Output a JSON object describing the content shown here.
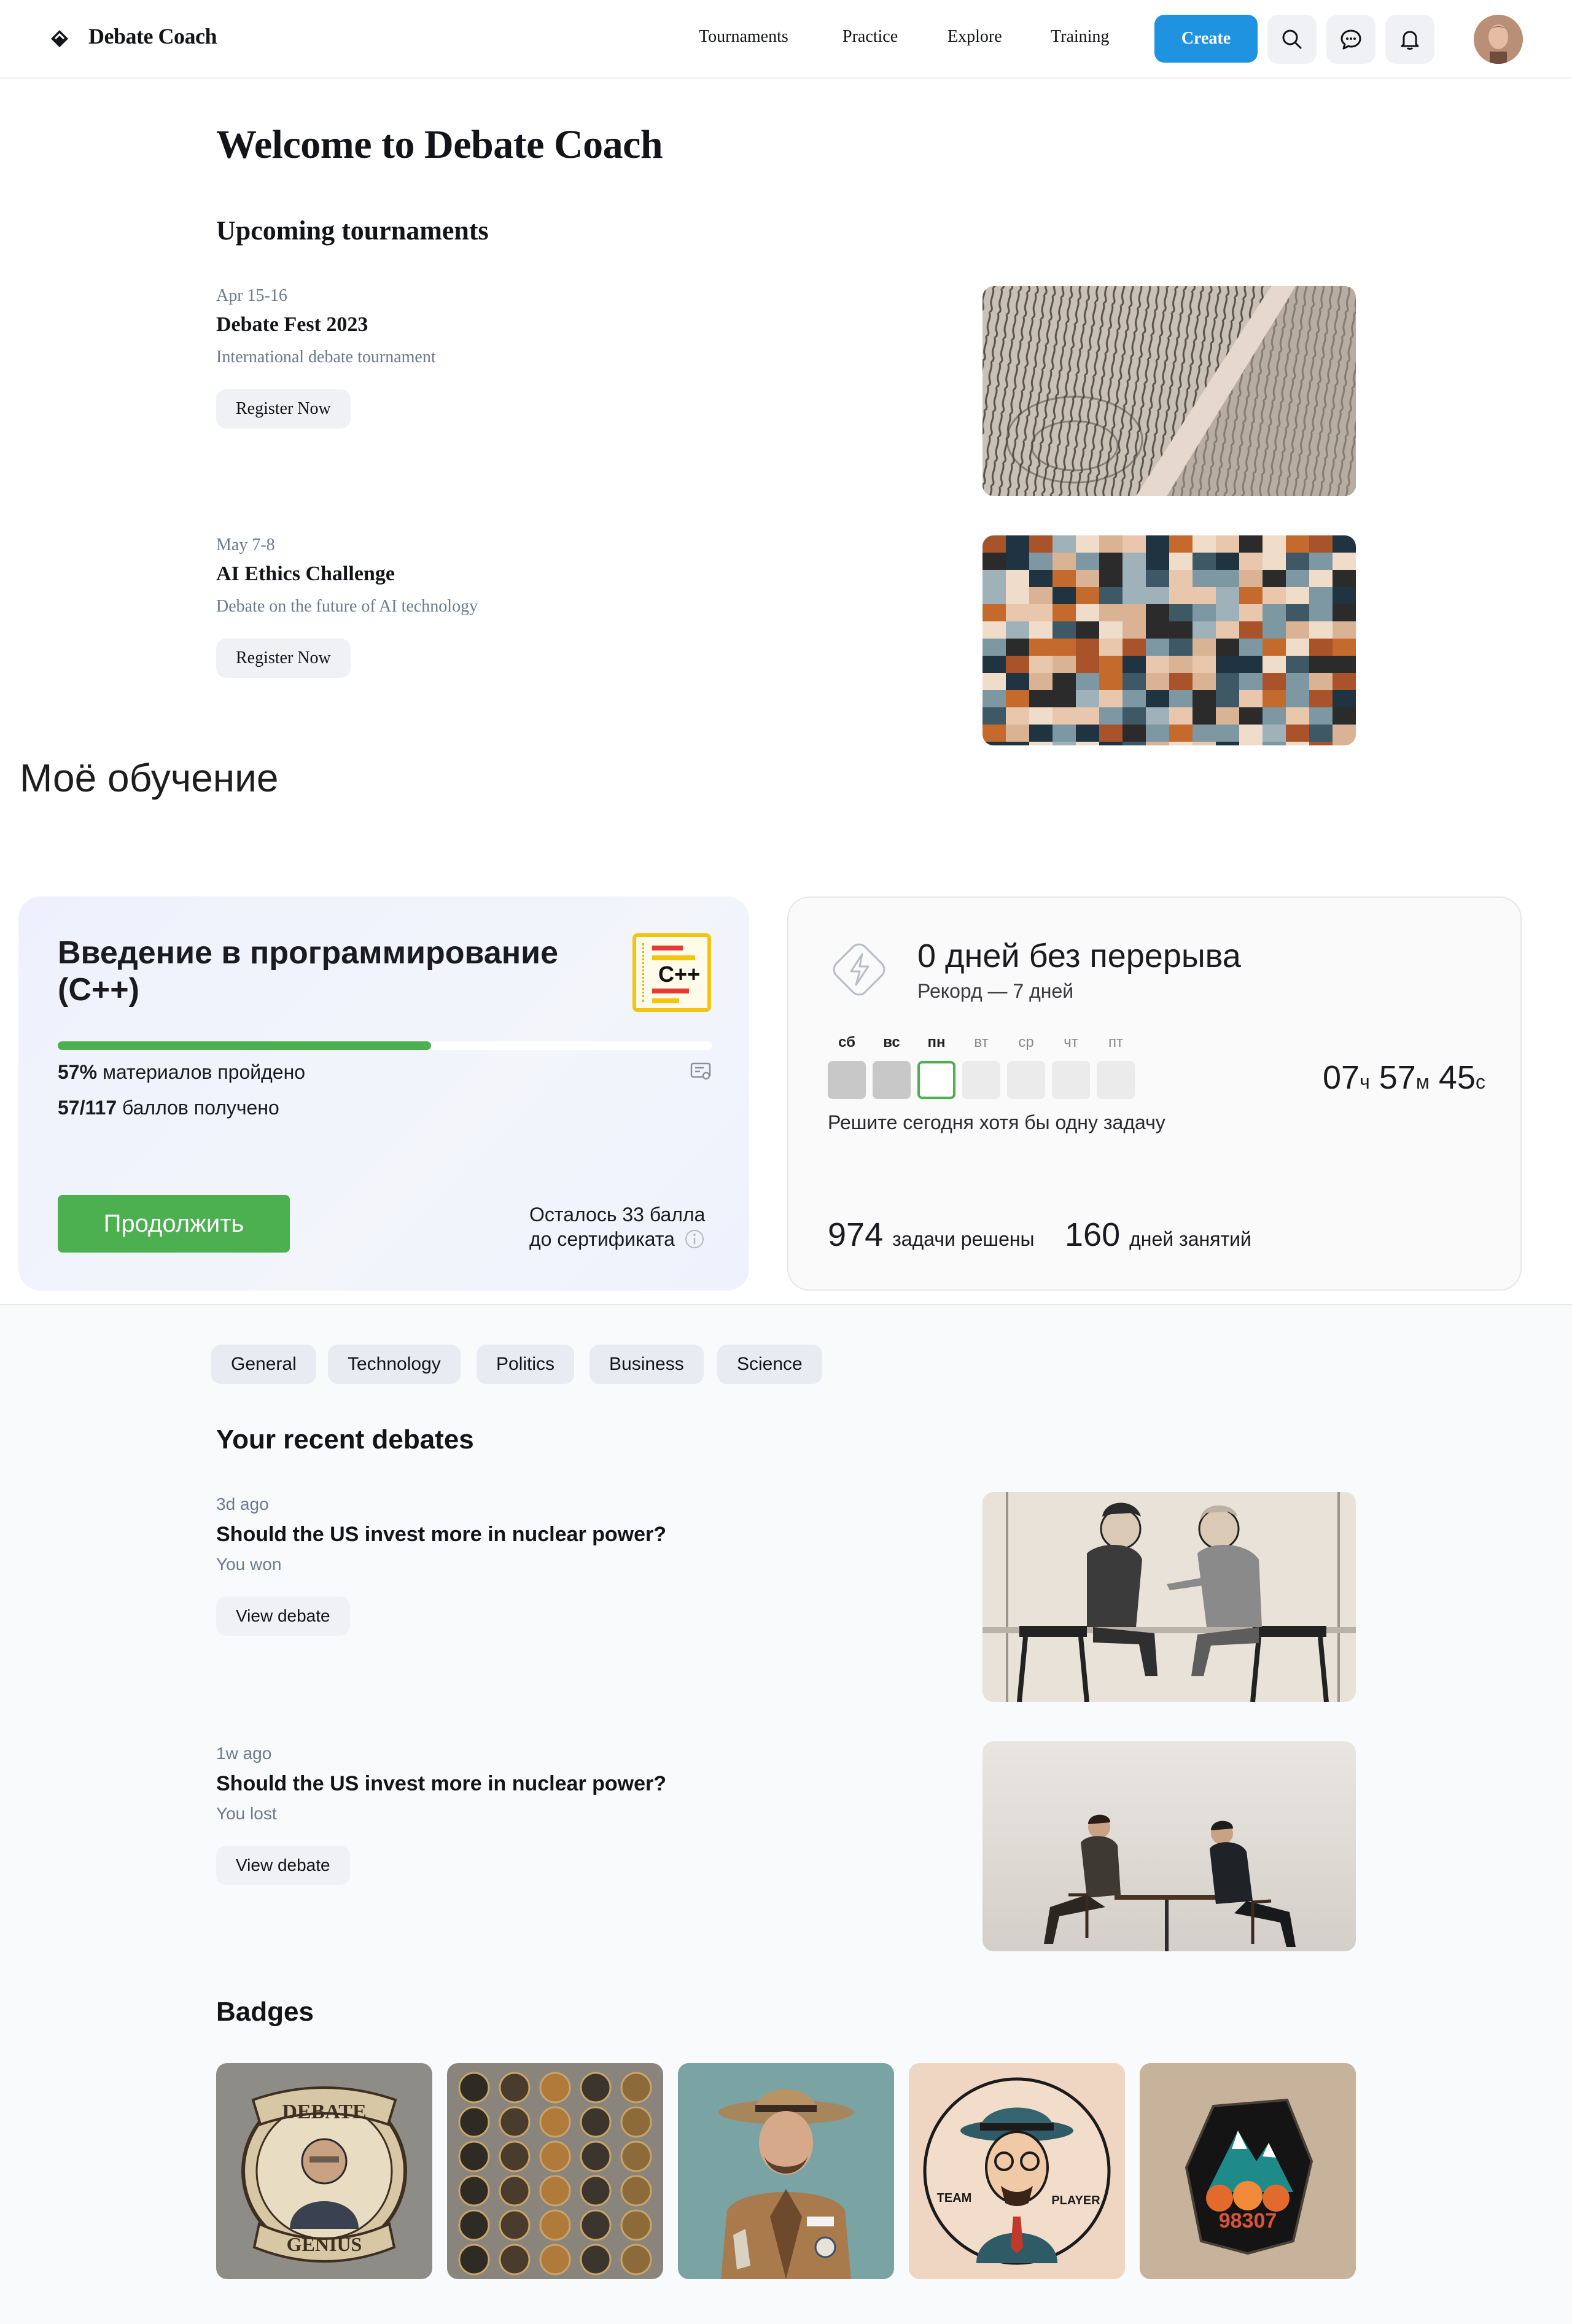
{
  "header": {
    "app_name": "Debate Coach",
    "nav": [
      "Tournaments",
      "Practice",
      "Explore",
      "Training"
    ],
    "create_label": "Create",
    "icons": [
      "search-icon",
      "chat-icon",
      "bell-icon"
    ]
  },
  "welcome": {
    "title": "Welcome to Debate Coach"
  },
  "tournaments": {
    "heading": "Upcoming tournaments",
    "items": [
      {
        "date": "Apr 15-16",
        "title": "Debate Fest 2023",
        "subtitle": "International debate tournament",
        "action": "Register Now"
      },
      {
        "date": "May 7-8",
        "title": "AI Ethics Challenge",
        "subtitle": "Debate on the future of AI technology",
        "action": "Register Now"
      }
    ]
  },
  "learning": {
    "heading": "Моё обучение",
    "course": {
      "title": "Введение в программирование (С++)",
      "icon_text": "C++",
      "progress_percent": 57,
      "materials_pct": "57%",
      "materials_text": "материалов пройдено",
      "points": "57/117",
      "points_text": "баллов получено",
      "continue_label": "Продолжить",
      "remaining_line1": "Осталось 33 балла",
      "remaining_line2": "до сертификата"
    },
    "streak": {
      "title": "0 дней без перерыва",
      "record": "Рекорд — 7 дней",
      "days": [
        "сб",
        "вс",
        "пн",
        "вт",
        "ср",
        "чт",
        "пт"
      ],
      "timer_h": "07",
      "timer_h_unit": "ч",
      "timer_m": "57",
      "timer_m_unit": "м",
      "timer_s": "45",
      "timer_s_unit": "с",
      "hint": "Решите сегодня хотя бы одну задачу",
      "solved_num": "974",
      "solved_text": "задачи решены",
      "days_num": "160",
      "days_text": "дней занятий"
    }
  },
  "categories": [
    "General",
    "Technology",
    "Politics",
    "Business",
    "Science"
  ],
  "debates": {
    "heading": "Your recent debates",
    "items": [
      {
        "time": "3d ago",
        "title": "Should the US invest more in nuclear power?",
        "result": "You won",
        "action": "View debate"
      },
      {
        "time": "1w ago",
        "title": "Should the US invest more in nuclear power?",
        "result": "You lost",
        "action": "View debate"
      }
    ]
  },
  "badges": {
    "heading": "Badges",
    "items": [
      {
        "name": "debate-genius-badge",
        "top": "DEBATE",
        "bottom": "GENIUS"
      },
      {
        "name": "coin-collection-badge"
      },
      {
        "name": "ranger-badge"
      },
      {
        "name": "team-player-badge",
        "left": "TEAM",
        "right": "PLAYER"
      },
      {
        "name": "mountain-patch-badge",
        "number": "98307"
      }
    ]
  }
}
